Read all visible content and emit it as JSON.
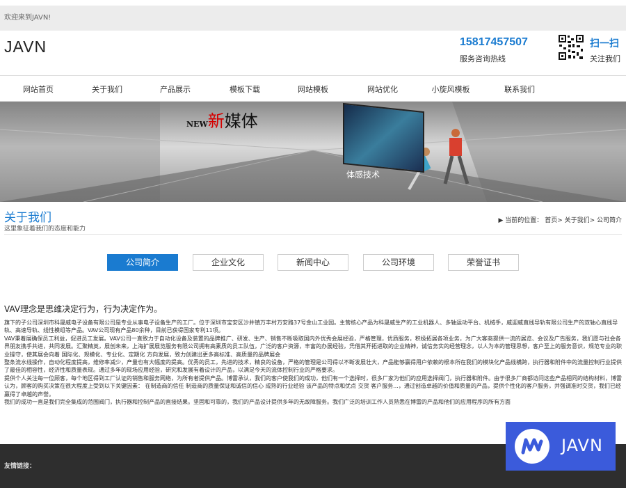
{
  "topbar": {
    "welcome": "欢迎来到JAVN!"
  },
  "header": {
    "logo": "JAVN",
    "phone": "15817457507",
    "phone_label": "服务咨询热线",
    "scan_title": "扫一扫",
    "scan_label": "关注我们"
  },
  "nav": {
    "items": [
      "网站首页",
      "关于我们",
      "产品展示",
      "模板下载",
      "网站模板",
      "网站优化",
      "小旋风模板",
      "联系我们"
    ]
  },
  "banner": {
    "new": "NEW",
    "xin": "新",
    "media": "媒体",
    "caption": "体感技术"
  },
  "section": {
    "title": "关于我们",
    "subtitle": "这里象征着我们的态度和能力",
    "breadcrumb_label": "当前的位置：",
    "breadcrumb": "首页> 关于我们> 公司简介"
  },
  "tabs": [
    "公司简介",
    "企业文化",
    "新闻中心",
    "公司环境",
    "荣誉证书"
  ],
  "content": {
    "slogan": "VAV理念是思维决定行为，行为决定作为。",
    "paragraphs": [
      "旗下的子公司深圳市科晟威电子设备有限公司是专业从事电子设备生产的工厂。位于深圳市宝安区沙井镇万丰村万安路37号金山工业园。主营核心产品为科晟威生产的工业机器人、多轴运动平台、机械手，威迎威直线导轨有限公司生产的双轴心直线导轨、高速导轨、线性模组等产品。VAV公司现有产品80余种，目前已获得国家专利11项。",
      "VAV秉着展确保员工利益，促进员工发展。VAV公司一直致力于自动化设备及装置的品牌推广、研发、生产、销售不断吸取国内外优秀会展经验，严格管理，优质服务，积极拓展各项业务，为广大客商提供一流的展览、会议及广告服务，我们愿与社会各界朋友携手共进，共同发展。汇聚精英，展创未来，上海扩展展览服务有限公司拥有高素质的员工队伍，广泛的客户资源，丰富的办展经验，凭借其开拓进取的企业精神，诚信务实的经营理念，以人为本的管理思想，客户至上的服务意识，规范专业的职业操守，使其展会向着 国际化、规模化、专业化、定期化 方向发展，致力创建出更多高标准、高质量的品牌展会",
      "整条流水线操作，自动化程度提高，维修率减少，产量也有大幅度的提高。优秀的员工，先进的技术，精良的设备，严格的管理是公司得以不断发展壮大，产品能够赢得用户依赖的根本所在我们的模块化产品线横跨，执行器和附件中的流量控制行业提供了最佳的相容性，经济性和质量表现。通过多年的现场应用经验，研究和发展有着设计的产品，以满足今天的流体控制行业的严格要求。",
      "提供个人关注每一位顾客，每个地区得到工厂认证的销售和服务网络，为所有者提供产品。博雷承认，我们的客户使我们的成功，他们有一个选择时，很多厂家为他们的应用选择阀门，执行器和附件。由于很多厂商都访问这些产品相同的结构材料，博雷认为，顾客的购买决策在很大程度上受到以下关键因素： 在制造商的信任 制造商的质量保证和诚信的信心 成熟的行业经验 该产品的特点和优点 交货 客户服务...，通过创造卓越的价值和质量的产品，提供个性化的客户服务，并强调准时交货，我们已经赢得了卓越的声誉。",
      "我们的成功一直是我们完全集成的范围阀门，执行器和控制产品的直接结果。坚固和可靠的，我们的产品设计提供多年的无故障服务。我们广泛的培训工作人员熟悉在博雷的产品和他们的应用程序的所有方面"
    ]
  },
  "footer": {
    "links_label": "友情链接："
  },
  "float_logo": {
    "text": "JAVN"
  },
  "colors": {
    "accent": "#1a7bd0",
    "footer": "#2e2e2e",
    "float": "#3b5bdb"
  }
}
